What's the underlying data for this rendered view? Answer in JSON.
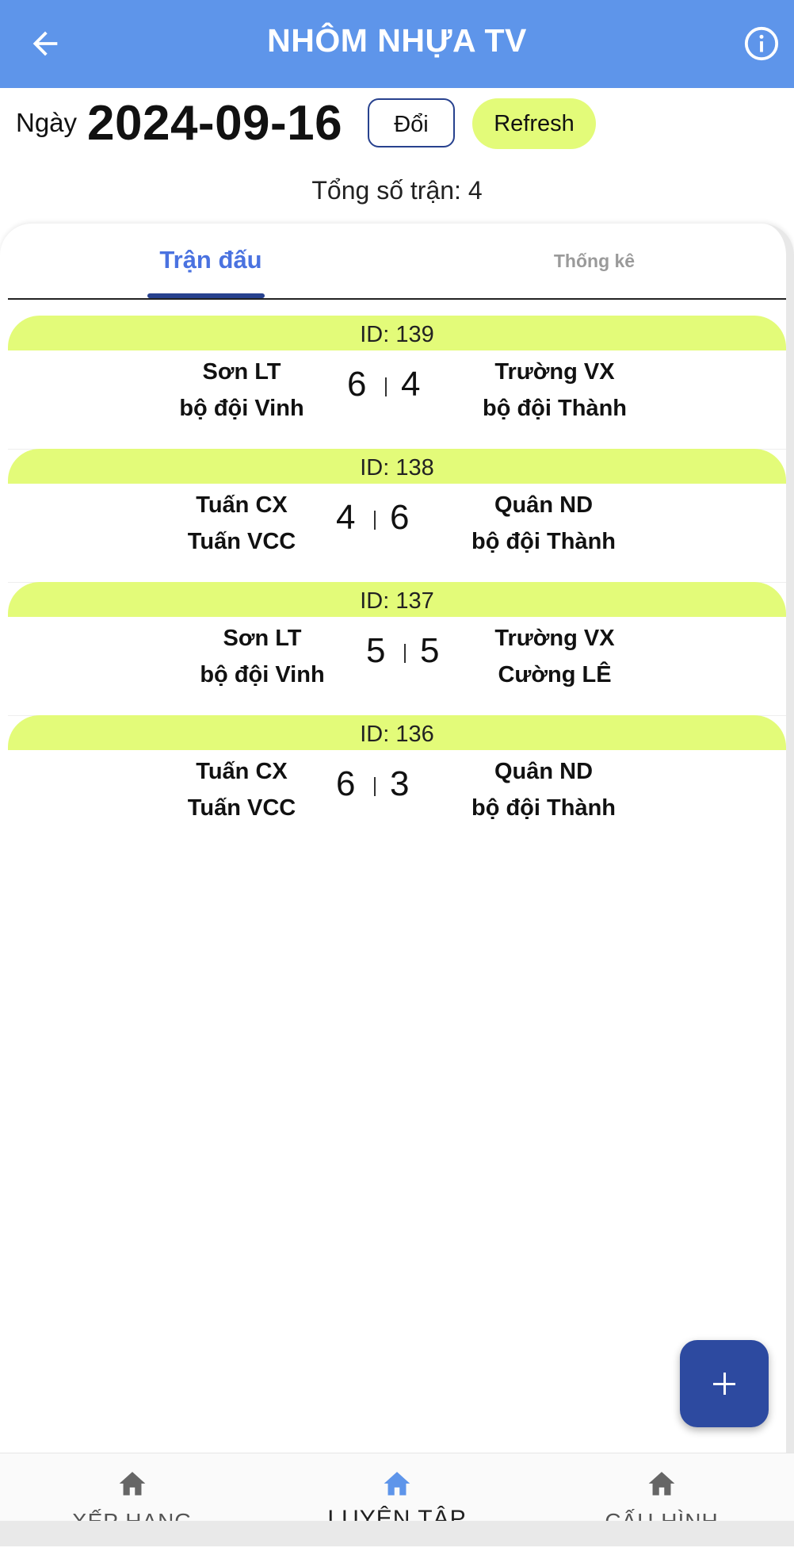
{
  "appbar": {
    "title": "NHÔM NHỰA TV",
    "back_icon": "arrow-left-icon",
    "info_icon": "info-circle-icon"
  },
  "date_row": {
    "label": "Ngày",
    "date": "2024-09-16",
    "change_button": "Đổi",
    "refresh_button": "Refresh"
  },
  "summary": {
    "total_matches": "Tổng số trận: 4"
  },
  "tabs": [
    {
      "label": "Trận đấu",
      "active": true
    },
    {
      "label": "Thống kê",
      "active": false
    }
  ],
  "matches": [
    {
      "id": "ID: 139",
      "team_a": [
        "Sơn LT",
        "bộ đội Vinh"
      ],
      "score_a": "6",
      "score_b": "4",
      "team_b": [
        "Trường VX",
        "bộ đội Thành"
      ]
    },
    {
      "id": "ID: 138",
      "team_a": [
        "Tuấn CX",
        "Tuấn VCC"
      ],
      "score_a": "4",
      "score_b": "6",
      "team_b": [
        "Quân ND",
        "bộ đội Thành"
      ]
    },
    {
      "id": "ID: 137",
      "team_a": [
        "Sơn LT",
        "bộ đội Vinh"
      ],
      "score_a": "5",
      "score_b": "5",
      "team_b": [
        "Trường VX",
        "Cường LÊ"
      ]
    },
    {
      "id": "ID: 136",
      "team_a": [
        "Tuấn CX",
        "Tuấn VCC"
      ],
      "score_a": "6",
      "score_b": "3",
      "team_b": [
        "Quân ND",
        "bộ đội Thành"
      ]
    }
  ],
  "fab": {
    "icon": "plus-icon"
  },
  "bottom_nav": [
    {
      "label": "XẾP HẠNG",
      "icon": "home-icon",
      "active": false
    },
    {
      "label": "LUYỆN TẬP",
      "icon": "home-icon",
      "active": true
    },
    {
      "label": "CẤU HÌNH",
      "icon": "home-icon",
      "active": false
    }
  ],
  "colors": {
    "appbar": "#5e95ea",
    "accent_yellow": "#e3fb79",
    "navy": "#2d4aa0",
    "tab_active": "#4a72e0"
  }
}
